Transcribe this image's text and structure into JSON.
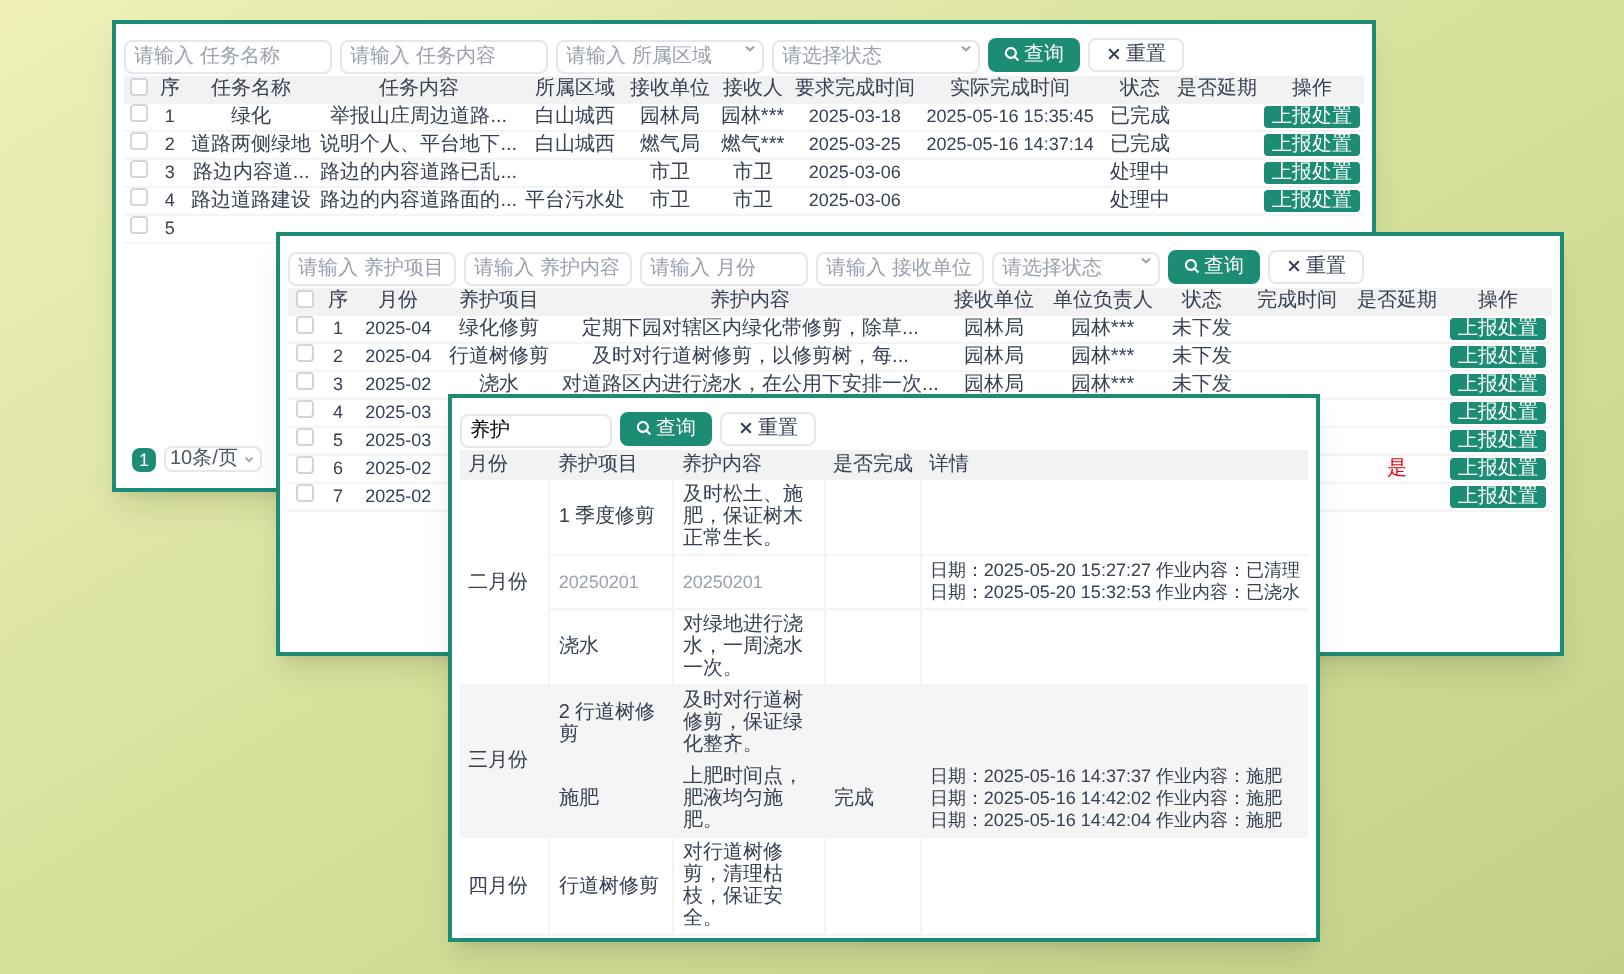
{
  "task_window": {
    "search": {
      "fields": [
        {
          "placeholder": "请输入 任务名称",
          "kind": "text"
        },
        {
          "placeholder": "请输入 任务内容",
          "kind": "text"
        },
        {
          "placeholder": "请输入 所属区域",
          "kind": "select"
        },
        {
          "placeholder": "请选择状态",
          "kind": "select"
        }
      ],
      "search_button": "查询",
      "reset_button": "重置"
    },
    "all_checked": false,
    "columns": [
      "序",
      "任务名称",
      "任务内容",
      "所属区域",
      "接收单位",
      "接收人",
      "要求完成时间",
      "实际完成时间",
      "状态",
      "是否延期",
      "操作"
    ],
    "rows": [
      {
        "checked": false,
        "cells": [
          "1",
          "绿化",
          "举报山庄周边道路...",
          "白山城西",
          "园林局",
          "园林***",
          "2025-03-18",
          "2025-05-16 15:35:45",
          "已完成"
        ],
        "action": "上报处置"
      },
      {
        "checked": false,
        "cells": [
          "2",
          "道路两侧绿地",
          "说明个人、平台地下...",
          "白山城西",
          "燃气局",
          "燃气***",
          "2025-03-25",
          "2025-05-16 14:37:14",
          "已完成"
        ],
        "action": "上报处置"
      },
      {
        "checked": false,
        "cells": [
          "3",
          "路边内容道...",
          "路边的内容道路已乱...",
          null,
          "市卫",
          "市卫",
          "2025-03-06",
          null,
          "处理中"
        ],
        "action": "上报处置"
      },
      {
        "checked": false,
        "cells": [
          "4",
          "路边道路建设",
          "路边的内容道路面的...",
          "平台污水处",
          "市卫",
          "市卫",
          "2025-03-06",
          null,
          "处理中"
        ],
        "action": "上报处置"
      },
      {
        "checked": false,
        "cells": [
          "5"
        ]
      }
    ],
    "pagination": {
      "pages": [
        {
          "label": "1",
          "selected": true
        }
      ],
      "page_size": "10条/页"
    }
  },
  "maintenance_window": {
    "search": {
      "fields": [
        {
          "placeholder": "请输入 养护项目",
          "kind": "text"
        },
        {
          "placeholder": "请输入 养护内容",
          "kind": "text"
        },
        {
          "placeholder": "请输入 月份",
          "kind": "text"
        },
        {
          "placeholder": "请输入 接收单位",
          "kind": "text"
        },
        {
          "placeholder": "请选择状态",
          "kind": "select"
        }
      ],
      "search_button": "查询",
      "reset_button": "重置"
    },
    "all_checked": false,
    "columns": [
      "序",
      "月份",
      "养护项目",
      "养护内容",
      "接收单位",
      "单位负责人",
      "状态",
      "完成时间",
      "是否延期",
      "操作"
    ],
    "rows": [
      {
        "checked": false,
        "cells": [
          "1",
          "2025-04",
          "绿化修剪",
          "定期下园对辖区内绿化带修剪，除草...",
          "园林局",
          "园林***",
          "未下发"
        ],
        "action": "上报处置"
      },
      {
        "checked": false,
        "cells": [
          "2",
          "2025-04",
          "行道树修剪",
          "及时对行道树修剪，以修剪树，每...",
          "园林局",
          "园林***",
          "未下发"
        ],
        "action": "上报处置"
      },
      {
        "checked": false,
        "cells": [
          "3",
          "2025-02",
          "浇水",
          "对道路区内进行浇水，在公用下安排一次...",
          "园林局",
          "园林***",
          "未下发"
        ],
        "action": "上报处置"
      },
      {
        "checked": false,
        "cells": [
          "4",
          "2025-03"
        ],
        "action": "上报处置"
      },
      {
        "checked": false,
        "cells": [
          "5",
          "2025-03"
        ],
        "action": "上报处置"
      },
      {
        "checked": false,
        "cells": [
          "6",
          "2025-02"
        ],
        "delay": "是",
        "overdue": true,
        "action": "上报处置"
      },
      {
        "checked": false,
        "cells": [
          "7",
          "2025-02"
        ],
        "action": "上报处置"
      }
    ]
  },
  "record_window": {
    "search": {
      "value": "养护",
      "search_button": "查询",
      "reset_button": "重置"
    },
    "columns": [
      "月份",
      "养护项目",
      "养护内容",
      "是否完成",
      "详情"
    ],
    "groups": [
      {
        "month": "二月份",
        "items": [
          {
            "project": "1 季度修剪",
            "content": "及时松土、施肥，保证树木正常生长。",
            "muted": false
          },
          {
            "project": "20250201",
            "content": "20250201",
            "muted": true,
            "details": [
              "日期：2025-05-20 15:27:27 作业内容：已清理",
              "日期：2025-05-20 15:32:53 作业内容：已浇水"
            ]
          },
          {
            "project": "浇水",
            "content": "对绿地进行浇水，一周浇水一次。",
            "muted": false
          }
        ]
      },
      {
        "month": "三月份",
        "items": [
          {
            "project": "2 行道树修剪",
            "content": "及时对行道树修剪，保证绿化整齐。",
            "muted": false
          },
          {
            "project": "施肥",
            "content": "上肥时间点，肥液均匀施肥。",
            "done": "完成",
            "muted": false,
            "details": [
              "日期：2025-05-16 14:37:37 作业内容：施肥",
              "日期：2025-05-16 14:42:02 作业内容：施肥",
              "日期：2025-05-16 14:42:04 作业内容：施肥"
            ]
          }
        ]
      },
      {
        "month": "四月份",
        "items": [
          {
            "project": "行道树修剪",
            "content": "对行道树修剪，清理枯枝，保证安全。",
            "muted": false
          }
        ]
      }
    ]
  }
}
